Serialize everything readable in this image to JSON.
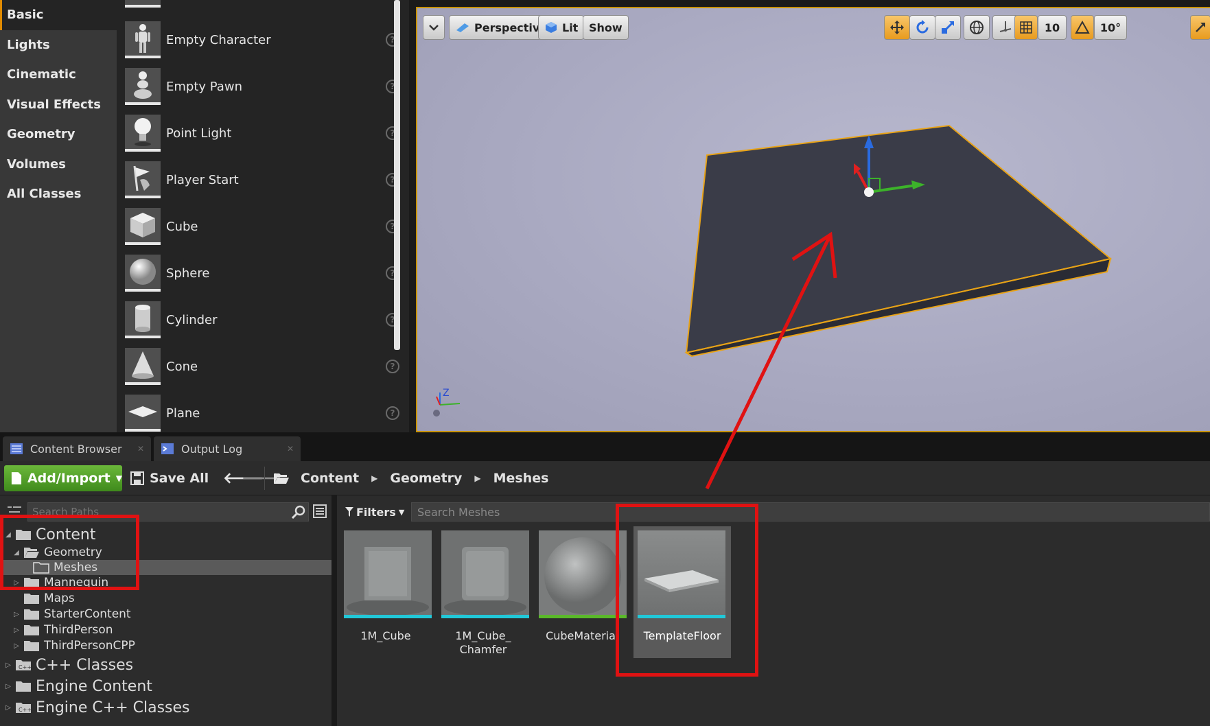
{
  "categories": [
    {
      "label": "Basic",
      "active": true
    },
    {
      "label": "Lights"
    },
    {
      "label": "Cinematic"
    },
    {
      "label": "Visual Effects"
    },
    {
      "label": "Geometry"
    },
    {
      "label": "Volumes"
    },
    {
      "label": "All Classes"
    }
  ],
  "actors": [
    {
      "label": "Empty Character",
      "icon": "character-icon"
    },
    {
      "label": "Empty Pawn",
      "icon": "pawn-icon"
    },
    {
      "label": "Point Light",
      "icon": "point-light-icon"
    },
    {
      "label": "Player Start",
      "icon": "player-start-icon"
    },
    {
      "label": "Cube",
      "icon": "cube-icon"
    },
    {
      "label": "Sphere",
      "icon": "sphere-icon"
    },
    {
      "label": "Cylinder",
      "icon": "cylinder-icon"
    },
    {
      "label": "Cone",
      "icon": "cone-icon"
    },
    {
      "label": "Plane",
      "icon": "plane-icon"
    }
  ],
  "viewport": {
    "perspective": "Perspective",
    "lit": "Lit",
    "show": "Show",
    "grid_snap": "10",
    "rotation_snap": "10°",
    "axis_z": "Z",
    "selection_color": "#e8a317"
  },
  "tabs": {
    "content_browser": "Content Browser",
    "output_log": "Output Log"
  },
  "toolbar": {
    "add_import": "Add/Import",
    "save_all": "Save All",
    "breadcrumbs": [
      "Content",
      "Geometry",
      "Meshes"
    ]
  },
  "tree": {
    "search_placeholder": "Search Paths",
    "items": [
      {
        "label": "Content",
        "level": 0,
        "expanded": true
      },
      {
        "label": "Geometry",
        "level": 1,
        "expanded": true
      },
      {
        "label": "Meshes",
        "level": 2,
        "selected": true
      },
      {
        "label": "Mannequin",
        "level": 1
      },
      {
        "label": "Maps",
        "level": 1
      },
      {
        "label": "StarterContent",
        "level": 1
      },
      {
        "label": "ThirdPerson",
        "level": 1
      },
      {
        "label": "ThirdPersonCPP",
        "level": 1
      },
      {
        "label": "C++ Classes",
        "level": 0
      },
      {
        "label": "Engine Content",
        "level": 0
      },
      {
        "label": "Engine C++ Classes",
        "level": 0
      }
    ]
  },
  "assets": {
    "filters_label": "Filters",
    "search_placeholder": "Search Meshes",
    "items": [
      {
        "label": "1M_Cube",
        "type": "static-mesh",
        "bar_color": "#21c8d8"
      },
      {
        "label": "1M_Cube_ Chamfer",
        "type": "static-mesh",
        "bar_color": "#21c8d8"
      },
      {
        "label": "CubeMateria",
        "type": "material",
        "bar_color": "#5ab82a"
      },
      {
        "label": "TemplateFloor",
        "type": "static-mesh",
        "bar_color": "#21c8d8",
        "selected": true
      }
    ]
  },
  "annotation_color": "#e01212"
}
